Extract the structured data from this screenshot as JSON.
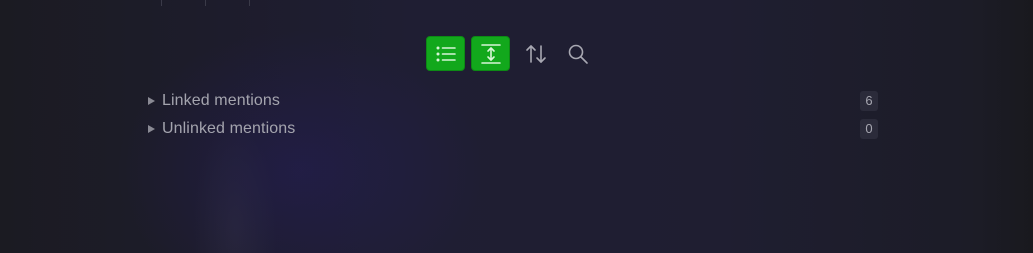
{
  "toolbar": {
    "buttons": [
      {
        "name": "collapse-results",
        "icon": "list-icon",
        "active": true
      },
      {
        "name": "show-more-context",
        "icon": "expand-vertical-icon",
        "active": true
      },
      {
        "name": "change-sort-order",
        "icon": "sort-arrows-icon",
        "active": false
      },
      {
        "name": "search",
        "icon": "search-icon",
        "active": false
      }
    ],
    "accent_color": "#12a81c"
  },
  "mentions": [
    {
      "label": "Linked mentions",
      "count": "6"
    },
    {
      "label": "Unlinked mentions",
      "count": "0"
    }
  ]
}
